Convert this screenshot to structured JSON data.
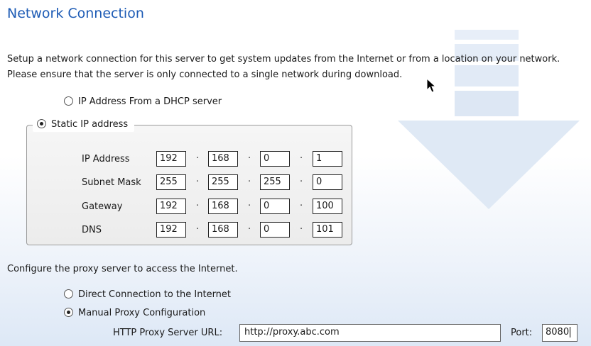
{
  "title": "Network Connection",
  "description": "Setup a network connection for this server to get system updates from the Internet or from a location on your network. Please ensure that the server is only connected to a single network during download.",
  "ip_mode": {
    "dhcp_label": "IP Address From a DHCP server",
    "static_label": "Static IP address",
    "selected": "static"
  },
  "static": {
    "rows": [
      {
        "label": "IP Address",
        "octets": [
          "192",
          "168",
          "0",
          "1"
        ]
      },
      {
        "label": "Subnet Mask",
        "octets": [
          "255",
          "255",
          "255",
          "0"
        ]
      },
      {
        "label": "Gateway",
        "octets": [
          "192",
          "168",
          "0",
          "100"
        ]
      },
      {
        "label": "DNS",
        "octets": [
          "192",
          "168",
          "0",
          "101"
        ]
      }
    ],
    "separator": "·"
  },
  "proxy": {
    "intro": "Configure the proxy server to access the Internet.",
    "direct_label": "Direct Connection to the Internet",
    "manual_label": "Manual Proxy Configuration",
    "selected": "manual",
    "url_label": "HTTP Proxy Server URL:",
    "url_value": "http://proxy.abc.com",
    "port_label": "Port:",
    "port_value": "8080"
  }
}
